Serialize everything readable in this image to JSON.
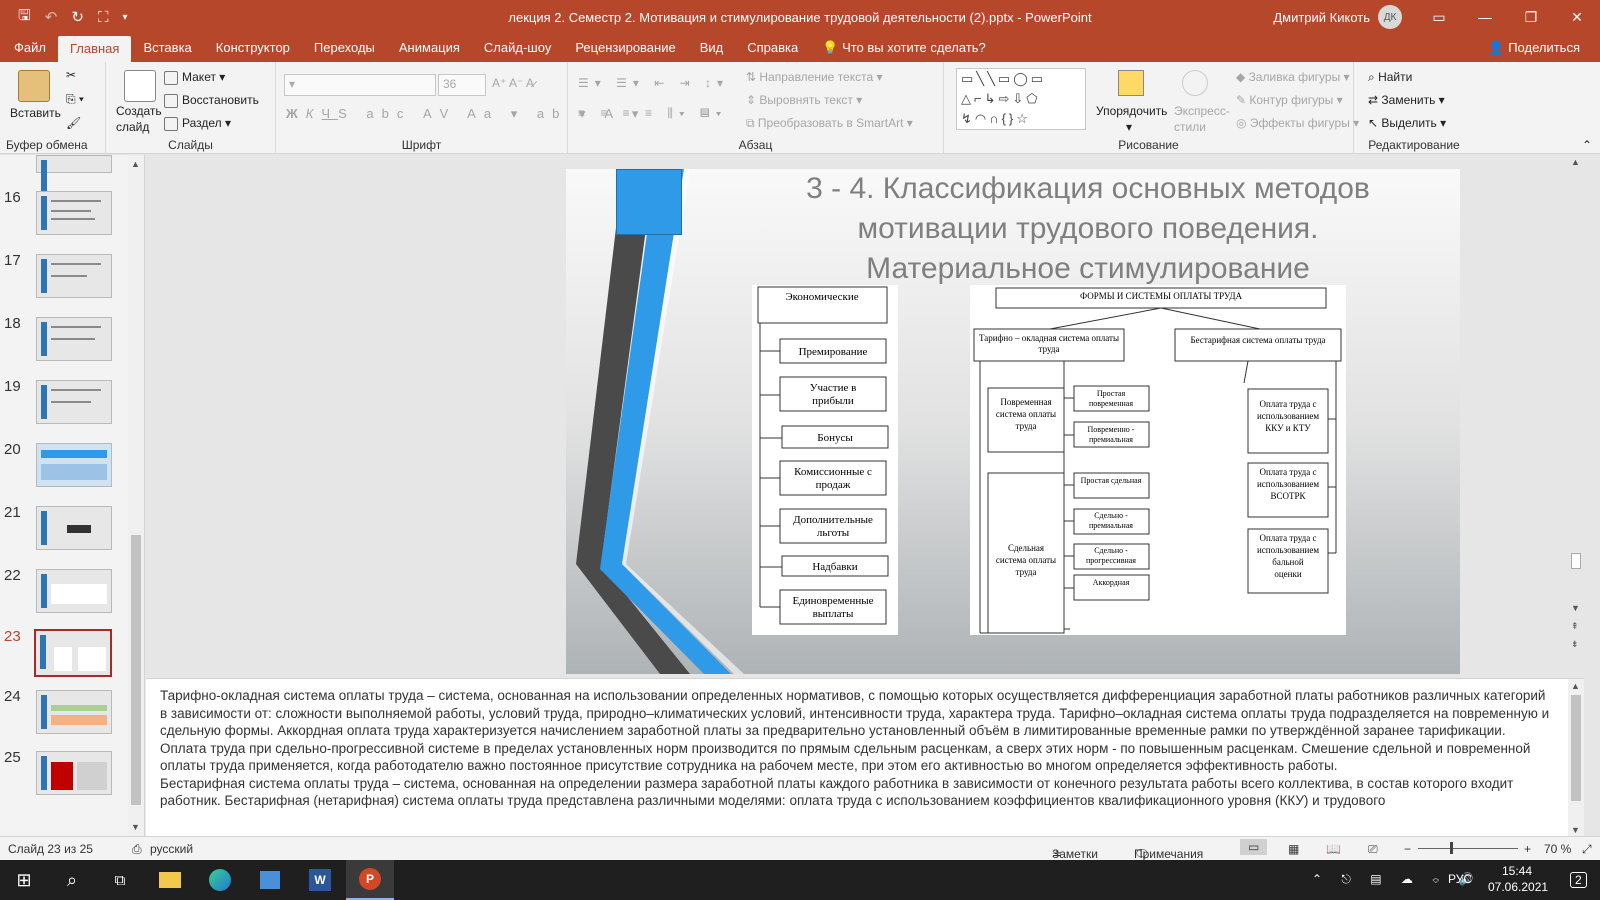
{
  "titlebar": {
    "document_title": "лекция 2. Семестр 2. Мотивация и стимулирование трудовой деятельности (2).pptx  -  PowerPoint",
    "user_name": "Дмитрий Кикоть",
    "user_initials": "ДК"
  },
  "menu": {
    "tabs": [
      "Файл",
      "Главная",
      "Вставка",
      "Конструктор",
      "Переходы",
      "Анимация",
      "Слайд-шоу",
      "Рецензирование",
      "Вид",
      "Справка"
    ],
    "active_tab": "Главная",
    "search_text": "Что вы хотите сделать?",
    "share_label": "Поделиться"
  },
  "ribbon": {
    "clipboard": {
      "paste": "Вставить",
      "group": "Буфер обмена"
    },
    "slides": {
      "new_slide_line1": "Создать",
      "new_slide_line2": "слайд",
      "layout": "Макет",
      "reset": "Восстановить",
      "section": "Раздел",
      "group": "Слайды"
    },
    "font": {
      "font_size": "36",
      "group": "Шрифт"
    },
    "paragraph": {
      "text_direction": "Направление текста",
      "align_text": "Выровнять текст",
      "convert_smartart": "Преобразовать в SmartArt",
      "group": "Абзац"
    },
    "drawing": {
      "arrange": "Упорядочить",
      "quick_styles_line1": "Экспресс-",
      "quick_styles_line2": "стили",
      "shape_fill": "Заливка фигуры",
      "shape_outline": "Контур фигуры",
      "shape_effects": "Эффекты фигуры",
      "group": "Рисование"
    },
    "editing": {
      "find": "Найти",
      "replace": "Заменить",
      "select": "Выделить",
      "group": "Редактирование"
    }
  },
  "thumbnails": {
    "numbers": [
      "16",
      "17",
      "18",
      "19",
      "20",
      "21",
      "22",
      "23",
      "24",
      "25"
    ],
    "selected": "23"
  },
  "slide": {
    "title_line1": "3 - 4. Классификация основных методов",
    "title_line2": "мотивации трудового поведения.",
    "title_line3": "Материальное стимулирование",
    "econ_diagram": {
      "header": "Экономические",
      "items": [
        "Премирование",
        "Участие в прибыли",
        "Бонусы",
        "Комиссионные с продаж",
        "Дополнительные льготы",
        "Надбавки",
        "Единовременные выплаты"
      ]
    },
    "pay_diagram": {
      "header": "ФОРМЫ И СИСТЕМЫ ОПЛАТЫ ТРУДА",
      "tariff": "Тарифно – окладная система оплаты труда",
      "nontariff": "Бестарифная система оплаты труда",
      "time_based": "Повременная система оплаты труда",
      "piece_based": "Сдельная система оплаты труда",
      "time_items": [
        "Простая повременная",
        "Повременно - премиальная"
      ],
      "piece_items": [
        "Простая сдельная",
        "Сдельно - премиальная",
        "Сдельно - прогрессивная",
        "Аккордная"
      ],
      "nontariff_items": [
        "Оплата труда с использованием ККУ и КТУ",
        "Оплата труда с использованием ВСОТРК",
        "Оплата труда с использованием бальной оценки"
      ]
    }
  },
  "notes": {
    "paragraph1": "Тарифно-окладная система оплаты труда – система, основанная на использовании определенных нормативов, с помощью которых осуществляется дифференциация заработной платы работников различных категорий в зависимости от: сложности выполняемой работы, условий труда, природно–климатических условий, интенсивности труда, характера труда. Тарифно–окладная система оплаты труда подразделяется на повременную и сдельную формы. Аккордная оплата труда характеризуется начислением заработной платы за предварительно установленный объём в лимитированные временные рамки по утверждённой заранее тарификации. Оплата труда при сдельно-прогрессивной системе в пределах установленных норм производится по прямым сдельным расценкам, а сверх этих норм - по повышенным расценкам. Смешение сдельной и повременной оплаты труда применяется, когда работодателю важно постоянное присутствие сотрудника на рабочем месте, при этом его активностью во многом определяется эффективность работы.",
    "paragraph2": "Бестарифная система оплаты труда – система, основанная на определении размера заработной платы каждого работника в зависимости от конечного результата работы всего коллектива, в состав которого входит работник. Бестарифная (нетарифная) система оплаты труда представлена различными моделями: оплата труда с использованием коэффициентов квалификационного уровня (ККУ) и трудового"
  },
  "status": {
    "slide_counter": "Слайд 23 из 25",
    "language": "русский",
    "notes_btn": "Заметки",
    "comments_btn": "Примечания",
    "zoom": "70 %"
  },
  "taskbar": {
    "lang": "РУС",
    "time": "15:44",
    "date": "07.06.2021",
    "notif": "2"
  },
  "colors": {
    "accent": "#b7472a",
    "ribbon_bg": "#f3f3f3",
    "slide_blue": "#2f9be8"
  }
}
